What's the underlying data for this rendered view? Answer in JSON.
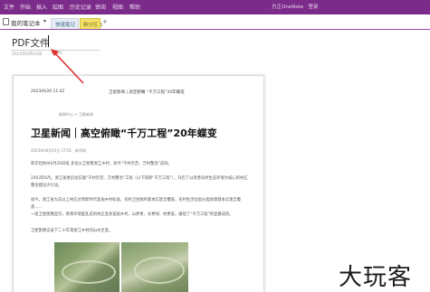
{
  "menu": {
    "items": [
      "文件",
      "开始",
      "插入",
      "绘图",
      "历史记录",
      "审阅",
      "视图",
      "帮助"
    ],
    "right_text": "方正OneNote · 登录"
  },
  "notebook": {
    "label": "我的笔记本",
    "sections": [
      "快速笔记",
      "新分区 1"
    ]
  },
  "page": {
    "title": "PDF文件",
    "date": "2023年6月20日",
    "time": "11:35"
  },
  "printout": {
    "datetime": "2023/6/20 11:42",
    "header": "卫星新闻 | 高空俯瞰 “千万工程”20年蝶变",
    "breadcrumb": "新闻中心 > 卫星新闻",
    "title": "卫星新闻｜高空俯瞰“千万工程”20年蝶变",
    "meta": "2023年06月19日 17:01 · 新华网",
    "paragraphs": [
      "新华社杭州6月20日电  多位从卫星看浙江乡村，如今“千村示范、万村整治”成效。",
      "2003年6月，浙江省委启动实施“千村示范、万村整治”工程（以下简称“千万工程”），开启了以改善农村生态环境为核心的村庄整治建设大行动。",
      "如今，浙江省九成以上村庄达到新时代美丽乡村标准，农村卫生厕所基本实现全覆盖，农村生活垃圾分类处理基本实现全覆盖……",
      "一组卫星图像显示，原来环境脏乱差的村庄变身美丽乡村，山更青、水更绿、村更美，展现了“千万工程”的显著成效。",
      "卫星影像记录下二十年来浙江乡村的山水巨变。"
    ]
  },
  "watermark": "大玩客",
  "colors": {
    "ribbon": "#7b2b89",
    "section_tab_1": "#e6edf5",
    "section_tab_2": "#f2e36c",
    "arrow": "#e0302c"
  }
}
